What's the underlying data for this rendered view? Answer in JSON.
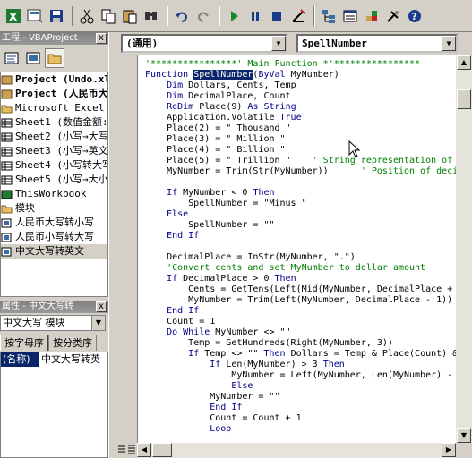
{
  "project_panel": {
    "title": "工程 - VBAProject",
    "close": "x",
    "items": [
      {
        "label": "Project (Undo.xla)",
        "bold": true,
        "icon": "vbaproject-icon"
      },
      {
        "label": "Project (人民币大",
        "bold": true,
        "icon": "vbaproject-icon"
      },
      {
        "label": "Microsoft Excel 对象",
        "bold": false,
        "icon": "folder-icon"
      },
      {
        "label": "Sheet1 (数值金额:",
        "bold": false,
        "icon": "sheet-icon"
      },
      {
        "label": "Sheet2 (小写→大写",
        "bold": false,
        "icon": "sheet-icon"
      },
      {
        "label": "Sheet3 (小写→英文",
        "bold": false,
        "icon": "sheet-icon"
      },
      {
        "label": "Sheet4 (小写转大写",
        "bold": false,
        "icon": "sheet-icon"
      },
      {
        "label": "Sheet5 (小写→大小",
        "bold": false,
        "icon": "sheet-icon"
      },
      {
        "label": "ThisWorkbook",
        "bold": false,
        "icon": "workbook-icon"
      },
      {
        "label": "模块",
        "bold": false,
        "icon": "folder-icon"
      },
      {
        "label": "人民币大写转小写",
        "bold": false,
        "icon": "module-icon"
      },
      {
        "label": "人民币小写转大写",
        "bold": false,
        "icon": "module-icon"
      },
      {
        "label": "中文大写转英文",
        "bold": false,
        "icon": "module-icon",
        "selected": true
      }
    ]
  },
  "properties_panel": {
    "title": "属性 - 中文大写转",
    "close": "x",
    "object": "中文大写 模块",
    "tabs": [
      "按字母序",
      "按分类序"
    ],
    "rows": [
      {
        "key": "(名称)",
        "value": "中文大写转英"
      }
    ]
  },
  "code_window": {
    "object_combo": "(通用)",
    "proc_combo": "SpellNumber",
    "lines": [
      [
        {
          "t": "'****************' Main Function *'****************",
          "c": "cm"
        }
      ],
      [
        {
          "t": "Function ",
          "c": "kw"
        },
        {
          "t": "SpellNumber",
          "c": "hl"
        },
        {
          "t": "(",
          "c": ""
        },
        {
          "t": "ByVal",
          "c": "kw"
        },
        {
          "t": " MyNumber)",
          "c": ""
        }
      ],
      [
        {
          "t": "    ",
          "c": ""
        },
        {
          "t": "Dim",
          "c": "kw"
        },
        {
          "t": " Dollars, Cents, Temp",
          "c": ""
        }
      ],
      [
        {
          "t": "    ",
          "c": ""
        },
        {
          "t": "Dim",
          "c": "kw"
        },
        {
          "t": " DecimalPlace, Count",
          "c": ""
        }
      ],
      [
        {
          "t": "    ",
          "c": ""
        },
        {
          "t": "ReDim",
          "c": "kw"
        },
        {
          "t": " Place(9) ",
          "c": ""
        },
        {
          "t": "As String",
          "c": "kw"
        }
      ],
      [
        {
          "t": "    Application.Volatile ",
          "c": ""
        },
        {
          "t": "True",
          "c": "kw"
        }
      ],
      [
        {
          "t": "    Place(2) = \" Thousand \"",
          "c": ""
        }
      ],
      [
        {
          "t": "    Place(3) = \" Million \"",
          "c": ""
        }
      ],
      [
        {
          "t": "    Place(4) = \" Billion \"",
          "c": ""
        }
      ],
      [
        {
          "t": "    Place(5) = \" Trillion \"    ",
          "c": ""
        },
        {
          "t": "' String representation of",
          "c": "cm"
        }
      ],
      [
        {
          "t": "    MyNumber = Trim(Str(MyNumber))      ",
          "c": ""
        },
        {
          "t": "' Position of decim",
          "c": "cm"
        }
      ],
      [
        {
          "t": "",
          "c": ""
        }
      ],
      [
        {
          "t": "    ",
          "c": ""
        },
        {
          "t": "If",
          "c": "kw"
        },
        {
          "t": " MyNumber < 0 ",
          "c": ""
        },
        {
          "t": "Then",
          "c": "kw"
        }
      ],
      [
        {
          "t": "        SpellNumber = \"Minus \"",
          "c": ""
        }
      ],
      [
        {
          "t": "    ",
          "c": ""
        },
        {
          "t": "Else",
          "c": "kw"
        }
      ],
      [
        {
          "t": "        SpellNumber = \"\"",
          "c": ""
        }
      ],
      [
        {
          "t": "    ",
          "c": ""
        },
        {
          "t": "End If",
          "c": "kw"
        }
      ],
      [
        {
          "t": "",
          "c": ""
        }
      ],
      [
        {
          "t": "    DecimalPlace = InStr(MyNumber, \".\")",
          "c": ""
        }
      ],
      [
        {
          "t": "    'Convert cents and set MyNumber to dollar amount",
          "c": "cm"
        }
      ],
      [
        {
          "t": "    ",
          "c": ""
        },
        {
          "t": "If",
          "c": "kw"
        },
        {
          "t": " DecimalPlace > 0 ",
          "c": ""
        },
        {
          "t": "Then",
          "c": "kw"
        }
      ],
      [
        {
          "t": "        Cents = GetTens(Left(Mid(MyNumber, DecimalPlace +",
          "c": ""
        }
      ],
      [
        {
          "t": "        MyNumber = Trim(Left(MyNumber, DecimalPlace - 1))",
          "c": ""
        }
      ],
      [
        {
          "t": "    ",
          "c": ""
        },
        {
          "t": "End If",
          "c": "kw"
        }
      ],
      [
        {
          "t": "    Count = 1",
          "c": ""
        }
      ],
      [
        {
          "t": "    ",
          "c": ""
        },
        {
          "t": "Do While",
          "c": "kw"
        },
        {
          "t": " MyNumber <> \"\"",
          "c": ""
        }
      ],
      [
        {
          "t": "        Temp = GetHundreds(Right(MyNumber, 3))",
          "c": ""
        }
      ],
      [
        {
          "t": "        ",
          "c": ""
        },
        {
          "t": "If",
          "c": "kw"
        },
        {
          "t": " Temp <> \"\" ",
          "c": ""
        },
        {
          "t": "Then",
          "c": "kw"
        },
        {
          "t": " Dollars = Temp & Place(Count) &",
          "c": ""
        }
      ],
      [
        {
          "t": "            ",
          "c": ""
        },
        {
          "t": "If",
          "c": "kw"
        },
        {
          "t": " Len(MyNumber) > 3 ",
          "c": ""
        },
        {
          "t": "Then",
          "c": "kw"
        }
      ],
      [
        {
          "t": "                MyNumber = Left(MyNumber, Len(MyNumber) - 3)",
          "c": ""
        }
      ],
      [
        {
          "t": "                ",
          "c": ""
        },
        {
          "t": "Else",
          "c": "kw"
        }
      ],
      [
        {
          "t": "            MyNumber = \"\"",
          "c": ""
        }
      ],
      [
        {
          "t": "            ",
          "c": ""
        },
        {
          "t": "End If",
          "c": "kw"
        }
      ],
      [
        {
          "t": "            Count = Count + 1",
          "c": ""
        }
      ],
      [
        {
          "t": "            ",
          "c": ""
        },
        {
          "t": "Loop",
          "c": "kw"
        }
      ]
    ]
  },
  "toolbar_icons": [
    "excel-icon",
    "insert-object-icon",
    "save-icon",
    "cut-icon",
    "copy-icon",
    "paste-icon",
    "find-icon",
    "undo-icon",
    "redo-icon",
    "run-icon",
    "break-icon",
    "reset-icon",
    "design-mode-icon",
    "project-explorer-icon",
    "properties-window-icon",
    "object-browser-icon",
    "toolbox-icon",
    "help-icon"
  ]
}
